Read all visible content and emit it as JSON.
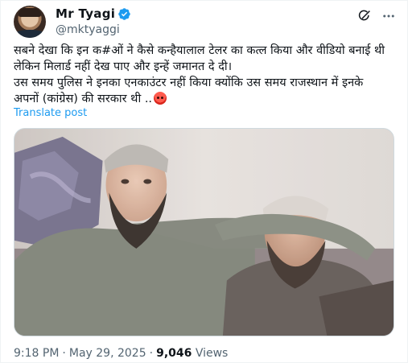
{
  "author": {
    "display_name": "Mr Tyagi",
    "handle": "@mktyaggi",
    "verified": true
  },
  "icons": {
    "verified": "verified-badge-icon",
    "grok": "grok-icon",
    "more": "more-icon"
  },
  "tweet": {
    "lines": [
      "सबने देखा कि इन क#ओं ने कैसे कन्हैयालाल टेलर का कत्ल किया और वीडियो बनाई थी",
      "लेकिन मिलार्ड नहीं देख पाए और इन्हें जमानत दे दी।",
      "उस समय पुलिस ने इनका एनकाउंटर नहीं किया क्योंकि उस समय राजस्थान में इनके",
      "अपनों (कांग्रेस) की सरकार थी .."
    ],
    "emoji": "angry-face-emoji",
    "translate_label": "Translate post"
  },
  "media": {
    "type": "video-thumbnail"
  },
  "meta": {
    "time": "9:18 PM",
    "date": "May 29, 2025",
    "separator": "·",
    "views_count": "9,046",
    "views_label": "Views"
  },
  "colors": {
    "accent": "#1d9bf0",
    "text": "#0f1419",
    "muted": "#536471",
    "border": "#cfd9de"
  }
}
